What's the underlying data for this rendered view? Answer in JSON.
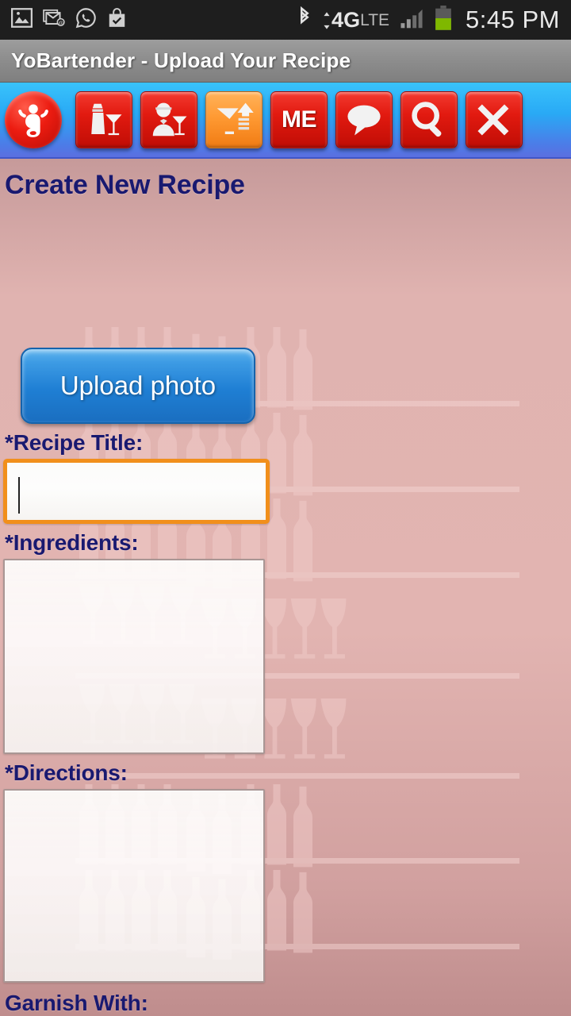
{
  "statusbar": {
    "icons_left": [
      "image-icon",
      "email-icon",
      "whatsapp-icon",
      "shopping-bag-check-icon"
    ],
    "icons_right": [
      "bluetooth-icon",
      "network-4glte-icon",
      "signal-bars-icon",
      "battery-icon"
    ],
    "network_label_primary": "4G",
    "network_label_secondary": "LTE",
    "time": "5:45 PM"
  },
  "titlebar": {
    "title": "YoBartender - Upload Your Recipe"
  },
  "toolbar": {
    "logo_name": "yobartender-logo",
    "buttons": [
      {
        "name": "drinks-button",
        "icon": "shaker-martini-icon",
        "label": "",
        "color": "#e21a10",
        "active": false
      },
      {
        "name": "bartender-button",
        "icon": "bartender-icon",
        "label": "",
        "color": "#e21a10",
        "active": false
      },
      {
        "name": "upload-button",
        "icon": "glass-upload-icon",
        "label": "",
        "color": "#ff9a33",
        "active": true
      },
      {
        "name": "me-button",
        "icon": "me-text-icon",
        "label": "ME",
        "color": "#e21a10",
        "active": false
      },
      {
        "name": "chat-button",
        "icon": "speech-bubble-icon",
        "label": "",
        "color": "#e21a10",
        "active": false
      },
      {
        "name": "search-button",
        "icon": "magnifier-icon",
        "label": "",
        "color": "#e21a10",
        "active": false
      },
      {
        "name": "close-button",
        "icon": "close-x-icon",
        "label": "",
        "color": "#e21a10",
        "active": false
      }
    ]
  },
  "main": {
    "page_title": "Create New Recipe",
    "upload_photo_label": "Upload photo",
    "fields": {
      "recipe_title": {
        "label": "*Recipe Title:",
        "value": "",
        "placeholder": "",
        "focused": true
      },
      "ingredients": {
        "label": "*Ingredients:",
        "value": "",
        "placeholder": "",
        "focused": false
      },
      "directions": {
        "label": "*Directions:",
        "value": "",
        "placeholder": "",
        "focused": false
      },
      "garnish": {
        "label": "Garnish With:",
        "value": "",
        "placeholder": "",
        "focused": false
      }
    }
  },
  "colors": {
    "accent_orange": "#f18f1b",
    "title_navy": "#191970",
    "toolbar_top": "#39c3fb",
    "toolbar_bottom": "#5b6fe0",
    "button_blue": "#1f7fd4",
    "icon_red": "#e21a10",
    "background_pink": "#e2b4b1",
    "battery_green": "#7fb800"
  }
}
